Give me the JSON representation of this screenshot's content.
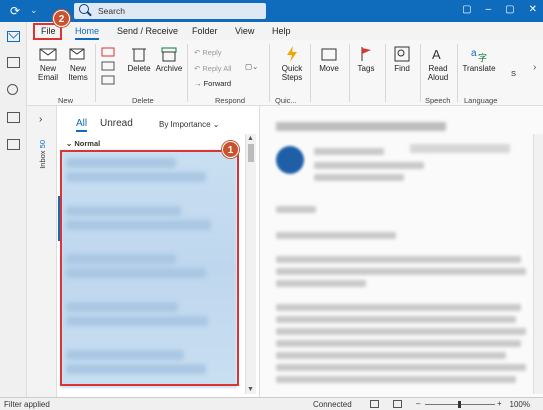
{
  "titlebar": {
    "search_placeholder": "Search",
    "window_buttons": [
      "▢",
      "–",
      "▢",
      "✕"
    ]
  },
  "tabs": [
    "File",
    "Home",
    "Send / Receive",
    "Folder",
    "View",
    "Help"
  ],
  "callouts": {
    "first": "1",
    "second": "2"
  },
  "ribbon": {
    "new_email": "New Email",
    "new_items": "New Items",
    "delete": "Delete",
    "archive": "Archive",
    "reply": "Reply",
    "reply_all": "Reply All",
    "forward": "Forward",
    "quick_steps": "Quick Steps",
    "move": "Move",
    "tags": "Tags",
    "find": "Find",
    "read_aloud": "Read Aloud",
    "translate": "Translate",
    "s_label": "S",
    "groups": {
      "new": "New",
      "delete": "Delete",
      "respond": "Respond",
      "quick": "Quic...",
      "speech": "Speech",
      "language": "Language"
    }
  },
  "folder_pane": {
    "inbox_label": "Inbox",
    "inbox_count": "50"
  },
  "message_list": {
    "filter_all": "All",
    "filter_unread": "Unread",
    "sort_label": "By Importance",
    "group_normal": "Normal"
  },
  "status": {
    "left": "Filter applied",
    "connection": "Connected",
    "zoom": "100%"
  }
}
